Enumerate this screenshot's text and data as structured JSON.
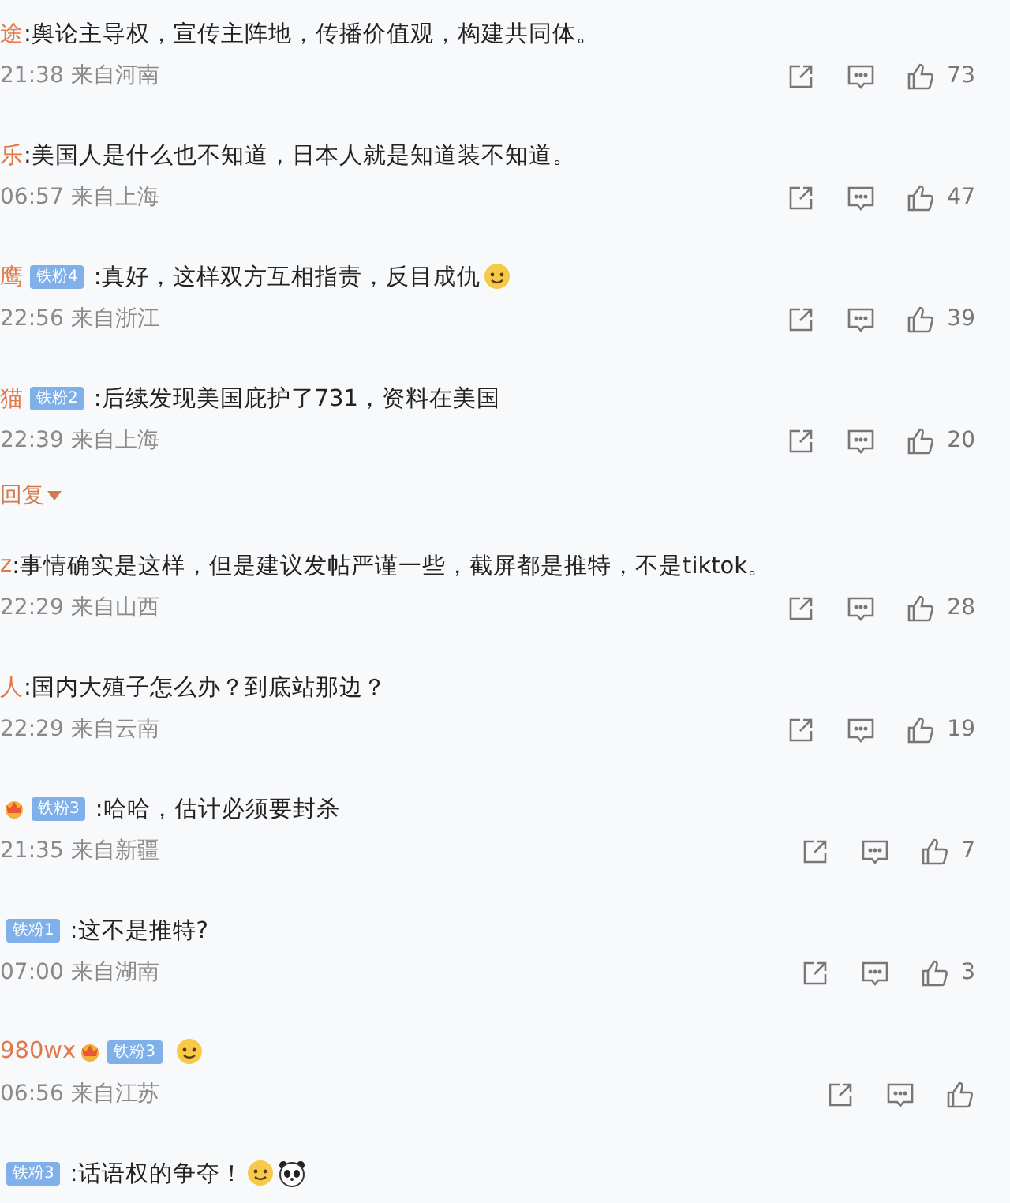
{
  "items": [
    {
      "kind": "comment",
      "name": "途",
      "text": ":舆论主导权，宣传主阵地，传播价值观，构建共同体。",
      "time": "21:38",
      "location": "来自河南",
      "likes": "73"
    },
    {
      "kind": "comment",
      "name": "乐",
      "text": ":美国人是什么也不知道，日本人就是知道装不知道。",
      "time": "06:57",
      "location": "来自上海",
      "likes": "47"
    },
    {
      "kind": "comment",
      "name": "鹰",
      "badge": "铁粉4",
      "text": ":真好，这样双方互相指责，反目成仇",
      "emojis": [
        {
          "kind": "face"
        }
      ],
      "time": "22:56",
      "location": "来自浙江",
      "likes": "39"
    },
    {
      "kind": "comment",
      "name": "猫",
      "badge": "铁粉2",
      "text": ":后续发现美国庇护了731，资料在美国",
      "time": "22:39",
      "location": "来自上海",
      "likes": "20"
    },
    {
      "kind": "reply_toggle",
      "label": "回复"
    },
    {
      "kind": "comment",
      "name": "z",
      "text": ":事情确实是这样，但是建议发帖严谨一些，截屏都是推特，不是tiktok。",
      "time": "22:29",
      "location": "来自山西",
      "likes": "28"
    },
    {
      "kind": "comment",
      "name": "人",
      "text": ":国内大殖子怎么办？到底站那边？",
      "time": "22:29",
      "location": "来自云南",
      "likes": "19"
    },
    {
      "kind": "comment",
      "medal": true,
      "badge": "铁粉3",
      "text": ":哈哈，估计必须要封杀",
      "time": "21:35",
      "location": "来自新疆",
      "likes": "7"
    },
    {
      "kind": "comment",
      "badge": "铁粉1",
      "text": ":这不是推特?",
      "time": "07:00",
      "location": "来自湖南",
      "likes": "3"
    },
    {
      "kind": "comment",
      "name": "980wx",
      "medal": true,
      "badge": "铁粉3",
      "emojis": [
        {
          "kind": "face"
        }
      ],
      "time": "06:56",
      "location": "来自江苏"
    },
    {
      "kind": "comment",
      "badge": "铁粉3",
      "text": ":话语权的争夺！",
      "emojis": [
        {
          "kind": "face"
        },
        {
          "kind": "panda"
        }
      ]
    }
  ]
}
